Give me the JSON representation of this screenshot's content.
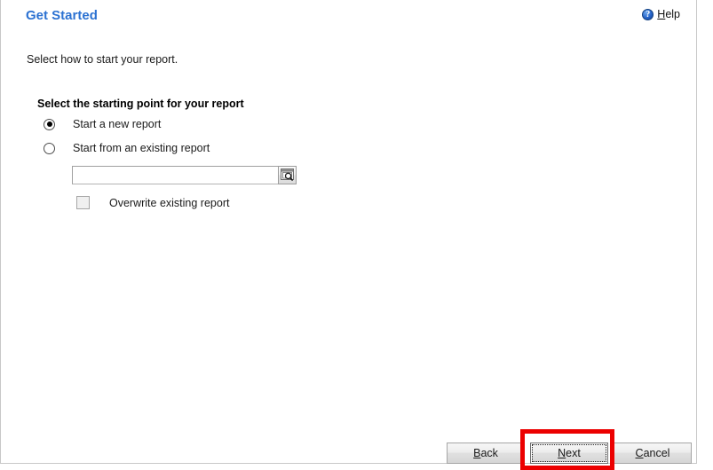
{
  "window": {
    "panel_background": "#ffffff",
    "border_color": "#c8c8c8"
  },
  "header": {
    "title": "Get Started",
    "title_color": "#2c72d2",
    "help": {
      "icon": "help-circle-icon",
      "accel": "H",
      "rest": "elp",
      "full_label": "Help"
    }
  },
  "main": {
    "instruction": "Select how to start your report.",
    "group_heading": "Select the starting point for your report",
    "options": [
      {
        "id": "start-new",
        "label": "Start a new report",
        "selected": true
      },
      {
        "id": "start-existing",
        "label": "Start from an existing report",
        "selected": false
      }
    ],
    "existing_report": {
      "value": "",
      "placeholder": "",
      "browse_icon": "search-browse-icon",
      "browse_tooltip": "Browse"
    },
    "overwrite": {
      "label": "Overwrite existing report",
      "checked": false
    }
  },
  "footer": {
    "buttons": [
      {
        "id": "back",
        "accel": "B",
        "before": "",
        "after": "ack",
        "full_label": "Back",
        "enabled": true,
        "focused": false
      },
      {
        "id": "next",
        "accel": "N",
        "before": "",
        "after": "ext",
        "full_label": "Next",
        "enabled": true,
        "focused": true
      },
      {
        "id": "cancel",
        "accel": "C",
        "before": "",
        "after": "ancel",
        "full_label": "Cancel",
        "enabled": true,
        "focused": false
      }
    ]
  },
  "annotation": {
    "target": "next-button",
    "color": "#ec0000",
    "style": "rectangle-highlight"
  }
}
